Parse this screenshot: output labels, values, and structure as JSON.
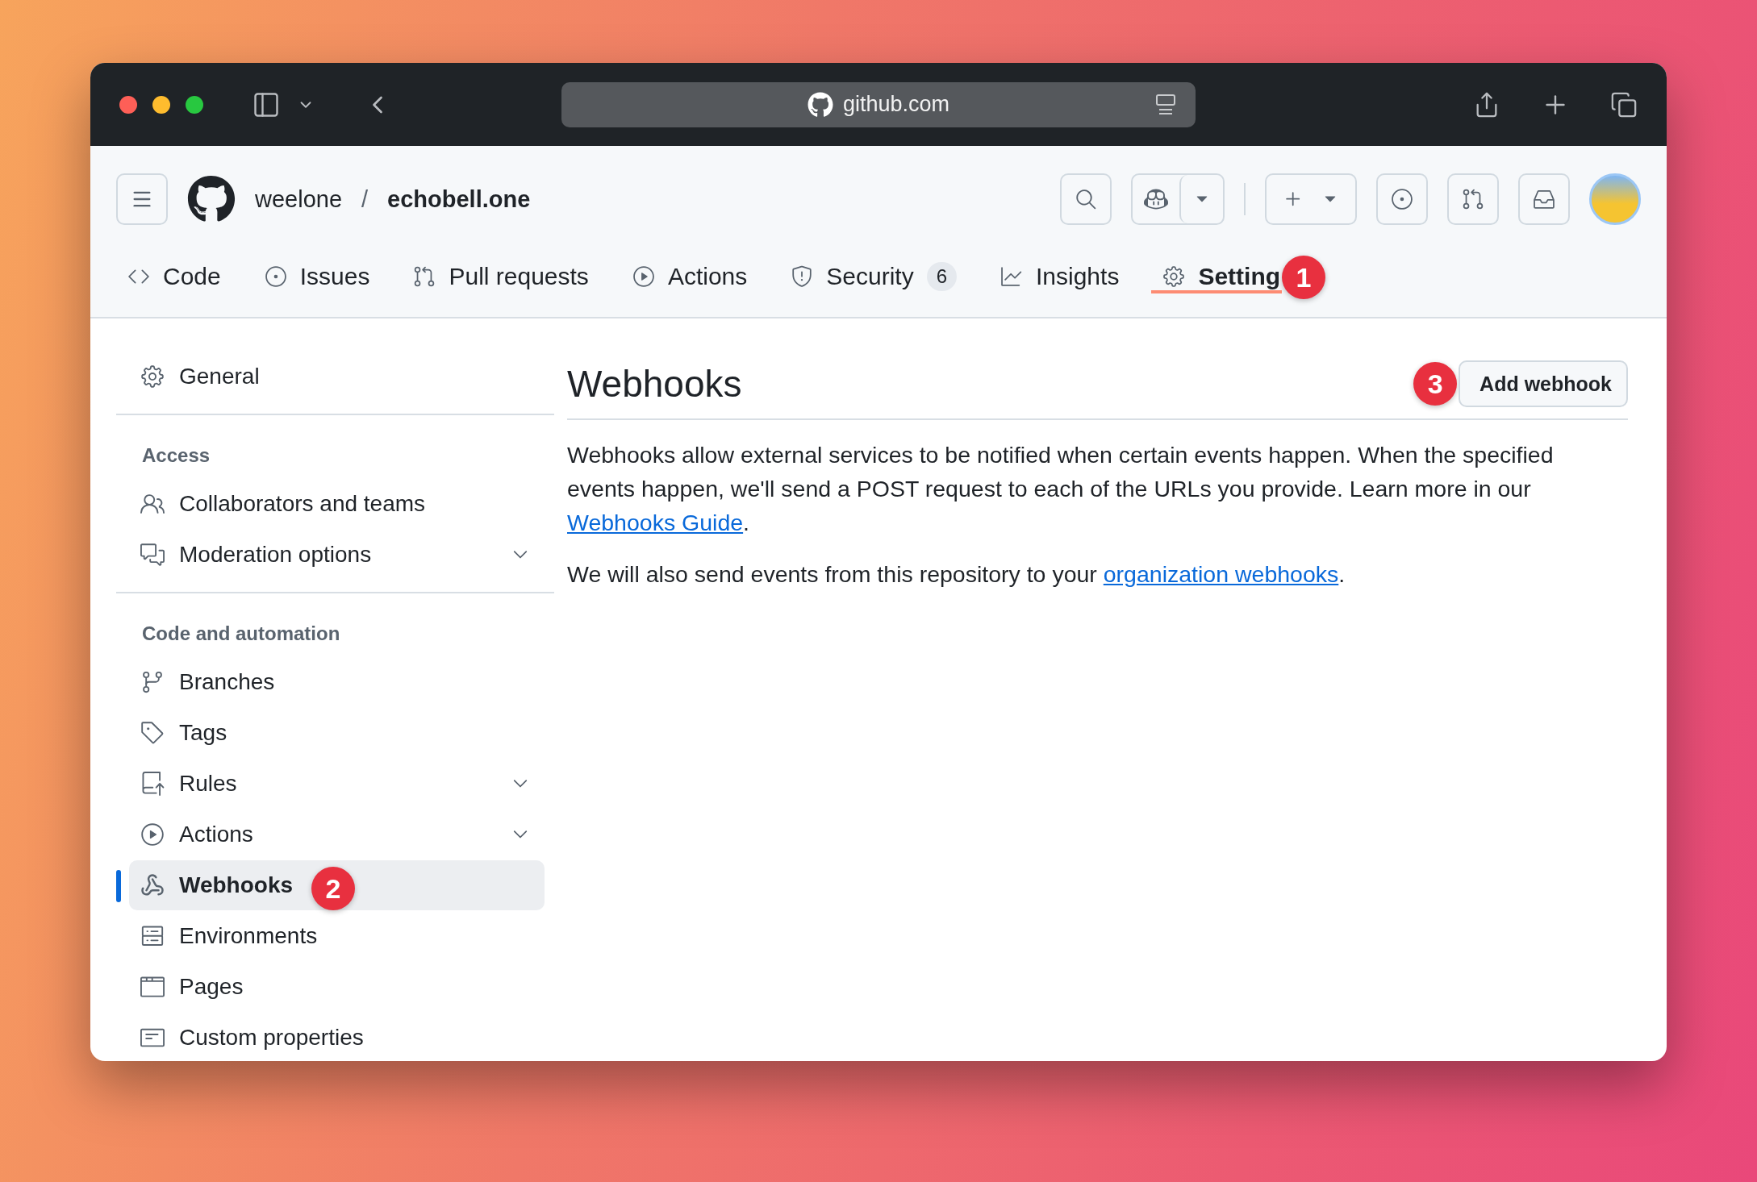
{
  "browser": {
    "url": "github.com"
  },
  "repo_header": {
    "owner": "weelone",
    "separator": "/",
    "repo": "echobell.one"
  },
  "tabs": [
    {
      "label": "Code",
      "selected": false
    },
    {
      "label": "Issues",
      "selected": false
    },
    {
      "label": "Pull requests",
      "selected": false
    },
    {
      "label": "Actions",
      "selected": false
    },
    {
      "label": "Security",
      "counter": "6",
      "selected": false
    },
    {
      "label": "Insights",
      "selected": false
    },
    {
      "label": "Setting",
      "selected": true,
      "callout": "1"
    }
  ],
  "sidebar": {
    "groups": [
      {
        "items": [
          {
            "label": "General",
            "selected": false,
            "expandable": false
          }
        ]
      },
      {
        "heading": "Access",
        "items": [
          {
            "label": "Collaborators and teams",
            "selected": false,
            "expandable": false
          },
          {
            "label": "Moderation options",
            "selected": false,
            "expandable": true
          }
        ]
      },
      {
        "heading": "Code and automation",
        "items": [
          {
            "label": "Branches",
            "selected": false,
            "expandable": false
          },
          {
            "label": "Tags",
            "selected": false,
            "expandable": false
          },
          {
            "label": "Rules",
            "selected": false,
            "expandable": true
          },
          {
            "label": "Actions",
            "selected": false,
            "expandable": true
          },
          {
            "label": "Webhooks",
            "selected": true,
            "expandable": false,
            "callout": "2"
          },
          {
            "label": "Environments",
            "selected": false,
            "expandable": false
          },
          {
            "label": "Pages",
            "selected": false,
            "expandable": false
          },
          {
            "label": "Custom properties",
            "selected": false,
            "expandable": false
          }
        ]
      }
    ]
  },
  "content": {
    "title": "Webhooks",
    "button": {
      "label": "Add webhook",
      "callout": "3"
    },
    "paragraphs": [
      [
        {
          "kind": "text",
          "text": "Webhooks allow external services to be notified when certain events happen. When the specified events happen, we'll send a POST request to each of the URLs you provide. Learn more in our "
        },
        {
          "kind": "link",
          "text": "Webhooks Guide"
        },
        {
          "kind": "text",
          "text": "."
        }
      ],
      [
        {
          "kind": "text",
          "text": "We will also send events from this repository to your "
        },
        {
          "kind": "link",
          "text": "organization webhooks"
        },
        {
          "kind": "text",
          "text": "."
        }
      ]
    ]
  }
}
